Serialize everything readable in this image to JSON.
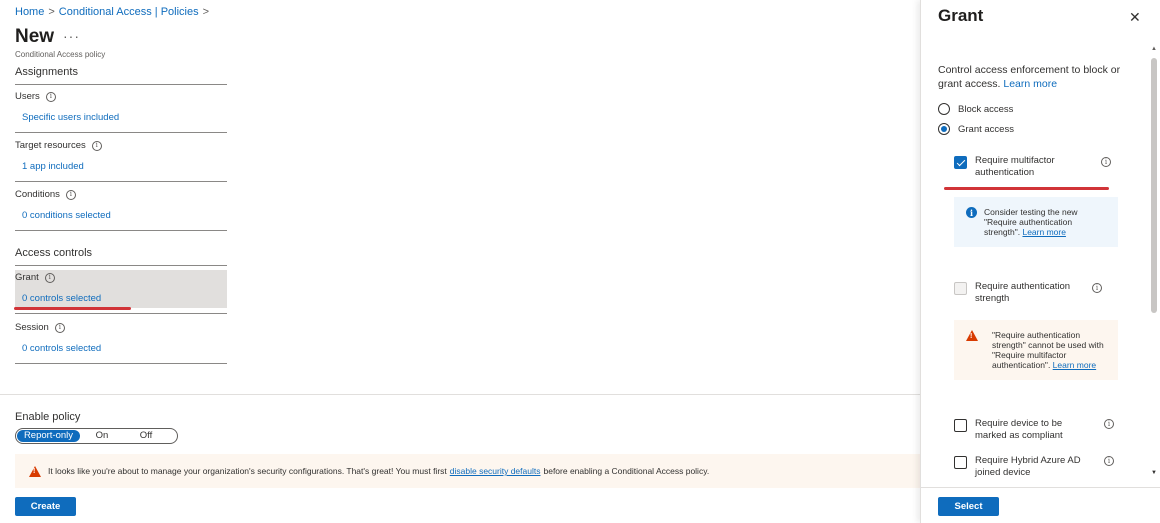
{
  "breadcrumb": {
    "home": "Home",
    "sep1": ">",
    "policies": "Conditional Access | Policies",
    "sep2": ">"
  },
  "page": {
    "title": "New",
    "more": "···",
    "subtitle": "Conditional Access policy"
  },
  "assignments": {
    "heading": "Assignments",
    "users": {
      "label": "Users",
      "value": "Specific users included"
    },
    "target": {
      "label": "Target resources",
      "value": "1 app included"
    },
    "conditions": {
      "label": "Conditions",
      "value": "0 conditions selected"
    }
  },
  "access_controls": {
    "heading": "Access controls",
    "grant": {
      "label": "Grant",
      "value": "0 controls selected"
    },
    "session": {
      "label": "Session",
      "value": "0 controls selected"
    }
  },
  "enable_policy": {
    "label": "Enable policy",
    "options": [
      "Report-only",
      "On",
      "Off"
    ],
    "selected": "Report-only"
  },
  "warning": {
    "text_before": "It looks like you're about to manage your organization's security configurations. That's great! You must first ",
    "link": "disable security defaults",
    "text_after": " before enabling a Conditional Access policy."
  },
  "create_button": "Create",
  "panel": {
    "title": "Grant",
    "close": "✕",
    "description": "Control access enforcement to block or grant access.",
    "learn_more": "Learn more",
    "block_access": "Block access",
    "grant_access": "Grant access",
    "require_mfa": "Require multifactor authentication",
    "mfa_info_text": "Consider testing the new \"Require authentication strength\". ",
    "mfa_info_link": "Learn more",
    "require_auth_strength": "Require authentication strength",
    "auth_warning_text": "\"Require authentication strength\" cannot be used with \"Require multifactor authentication\". ",
    "auth_warning_link": "Learn more",
    "require_compliant": "Require device to be marked as compliant",
    "require_hybrid": "Require Hybrid Azure AD joined device",
    "select_button": "Select",
    "scroll_up": "▲",
    "scroll_down": "▼"
  },
  "icons": {
    "info": "i",
    "warning": "!"
  },
  "colors": {
    "accent": "#0f6cbd",
    "highlight_line": "#d13438",
    "warning": "#d83b01"
  }
}
